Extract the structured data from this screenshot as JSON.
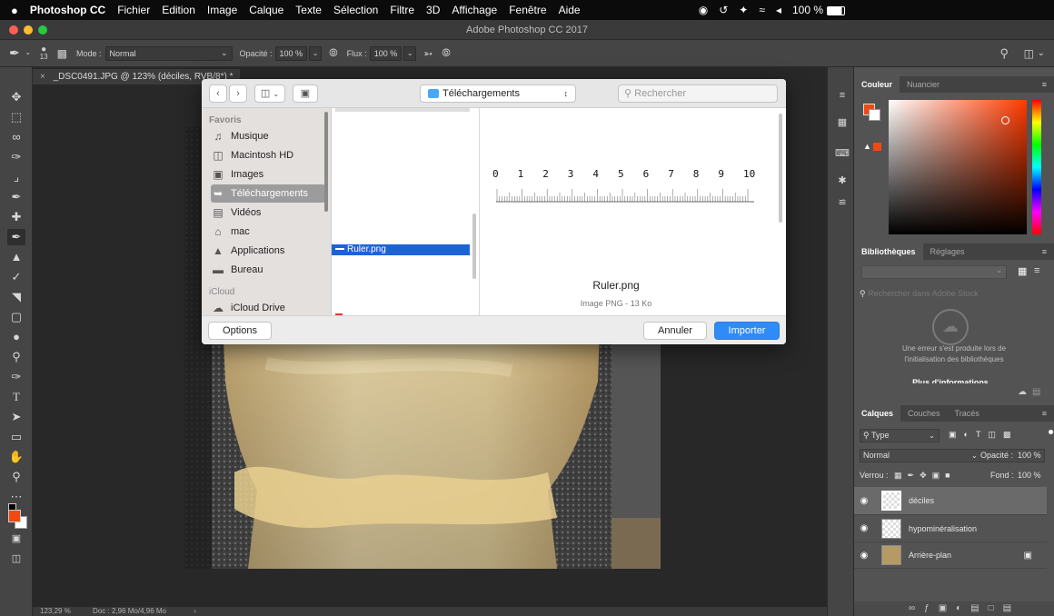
{
  "menubar": {
    "apple": "",
    "items": [
      "Photoshop CC",
      "Fichier",
      "Edition",
      "Image",
      "Calque",
      "Texte",
      "Sélection",
      "Filtre",
      "3D",
      "Affichage",
      "Fenêtre",
      "Aide"
    ],
    "battery": "100 %"
  },
  "window": {
    "title": "Adobe Photoshop CC 2017"
  },
  "options": {
    "brush_size": "13",
    "mode_label": "Mode :",
    "mode_value": "Normal",
    "opacity_label": "Opacité :",
    "opacity_value": "100 %",
    "flux_label": "Flux :",
    "flux_value": "100 %"
  },
  "document": {
    "tab_title": "_DSC0491.JPG @ 123% (déciles, RVB/8*) *",
    "zoom": "123,29 %",
    "doc_size": "Doc : 2,96 Mo/4,96 Mo"
  },
  "dialog": {
    "location": "Téléchargements",
    "search_placeholder": "Rechercher",
    "favorites_label": "Favoris",
    "icloud_label": "iCloud",
    "sidebar": [
      {
        "label": "Musique",
        "icon": "music-note"
      },
      {
        "label": "Macintosh HD",
        "icon": "drive"
      },
      {
        "label": "Images",
        "icon": "camera"
      },
      {
        "label": "Téléchargements",
        "icon": "download"
      },
      {
        "label": "Vidéos",
        "icon": "film"
      },
      {
        "label": "mac",
        "icon": "home"
      },
      {
        "label": "Applications",
        "icon": "applications"
      },
      {
        "label": "Bureau",
        "icon": "desktop"
      }
    ],
    "icloud_item": "iCloud Drive",
    "selected_file": "Ruler.png",
    "ruler_numbers": [
      "0",
      "1",
      "2",
      "3",
      "4",
      "5",
      "6",
      "7",
      "8",
      "9",
      "10"
    ],
    "preview_name": "Ruler.png",
    "preview_info": "Image PNG - 13 Ko",
    "options_button": "Options",
    "cancel_button": "Annuler",
    "import_button": "Importer"
  },
  "panels": {
    "color_tabs": [
      "Couleur",
      "Nuancier"
    ],
    "libraries_tabs": [
      "Bibliothèques",
      "Réglages"
    ],
    "libraries_search": "Rechercher dans Adobe Stock",
    "libraries_error": "Une erreur s'est produite lors de l'initialisation des bibliothèques",
    "libraries_more": "Plus d'informations",
    "layers_tabs": [
      "Calques",
      "Couches",
      "Tracés"
    ],
    "layers_filter": "Type",
    "blend_mode": "Normal",
    "opacity_label": "Opacité :",
    "opacity_value": "100 %",
    "lock_label": "Verrou :",
    "fill_label": "Fond :",
    "fill_value": "100 %",
    "layers": [
      {
        "name": "déciles"
      },
      {
        "name": "hypominéralisation"
      },
      {
        "name": "Arrière-plan"
      }
    ]
  },
  "colors": {
    "foreground": "#f04a12",
    "background": "#ffffff",
    "accent_blue": "#2f8bf7",
    "selection_blue": "#1e63d6"
  }
}
